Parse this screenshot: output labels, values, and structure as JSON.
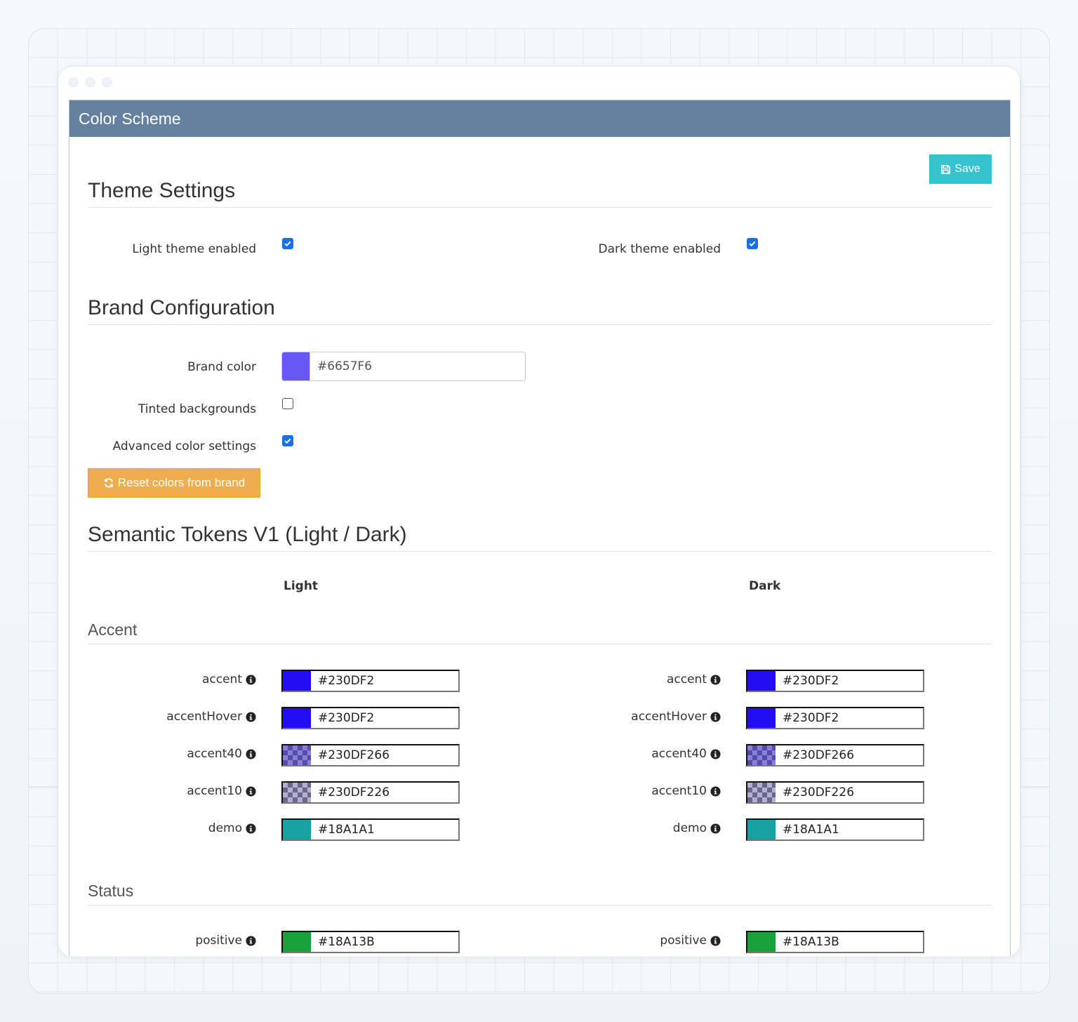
{
  "panel": {
    "title": "Color Scheme"
  },
  "toolbar": {
    "save_label": "Save"
  },
  "theme": {
    "title": "Theme Settings",
    "light_label": "Light theme enabled",
    "light_checked": true,
    "dark_label": "Dark theme enabled",
    "dark_checked": true
  },
  "brand": {
    "title": "Brand Configuration",
    "color_label": "Brand color",
    "color_value": "#6657F6",
    "tinted_label": "Tinted backgrounds",
    "tinted_checked": false,
    "advanced_label": "Advanced color settings",
    "advanced_checked": true,
    "reset_label": "Reset colors from brand"
  },
  "semantic": {
    "title": "Semantic Tokens V1 (Light / Dark)",
    "light_header": "Light",
    "dark_header": "Dark",
    "accent_group": "Accent",
    "status_group": "Status",
    "accent_tokens": [
      {
        "name": "accent",
        "light": "#230DF2",
        "dark": "#230DF2",
        "alpha": 1.0
      },
      {
        "name": "accentHover",
        "light": "#230DF2",
        "dark": "#230DF2",
        "alpha": 1.0
      },
      {
        "name": "accent40",
        "light": "#230DF266",
        "dark": "#230DF266",
        "alpha": 0.4
      },
      {
        "name": "accent10",
        "light": "#230DF226",
        "dark": "#230DF226",
        "alpha": 0.15
      },
      {
        "name": "demo",
        "light": "#18A1A1",
        "dark": "#18A1A1",
        "alpha": 1.0
      }
    ],
    "status_tokens": [
      {
        "name": "positive",
        "light": "#18A13B",
        "dark": "#18A13B",
        "alpha": 1.0
      }
    ]
  },
  "colors": {
    "header_bg": "#66809F",
    "save_bg": "#35C4CF",
    "reset_bg": "#F0AD4E",
    "checkbox": "#1670E8"
  }
}
